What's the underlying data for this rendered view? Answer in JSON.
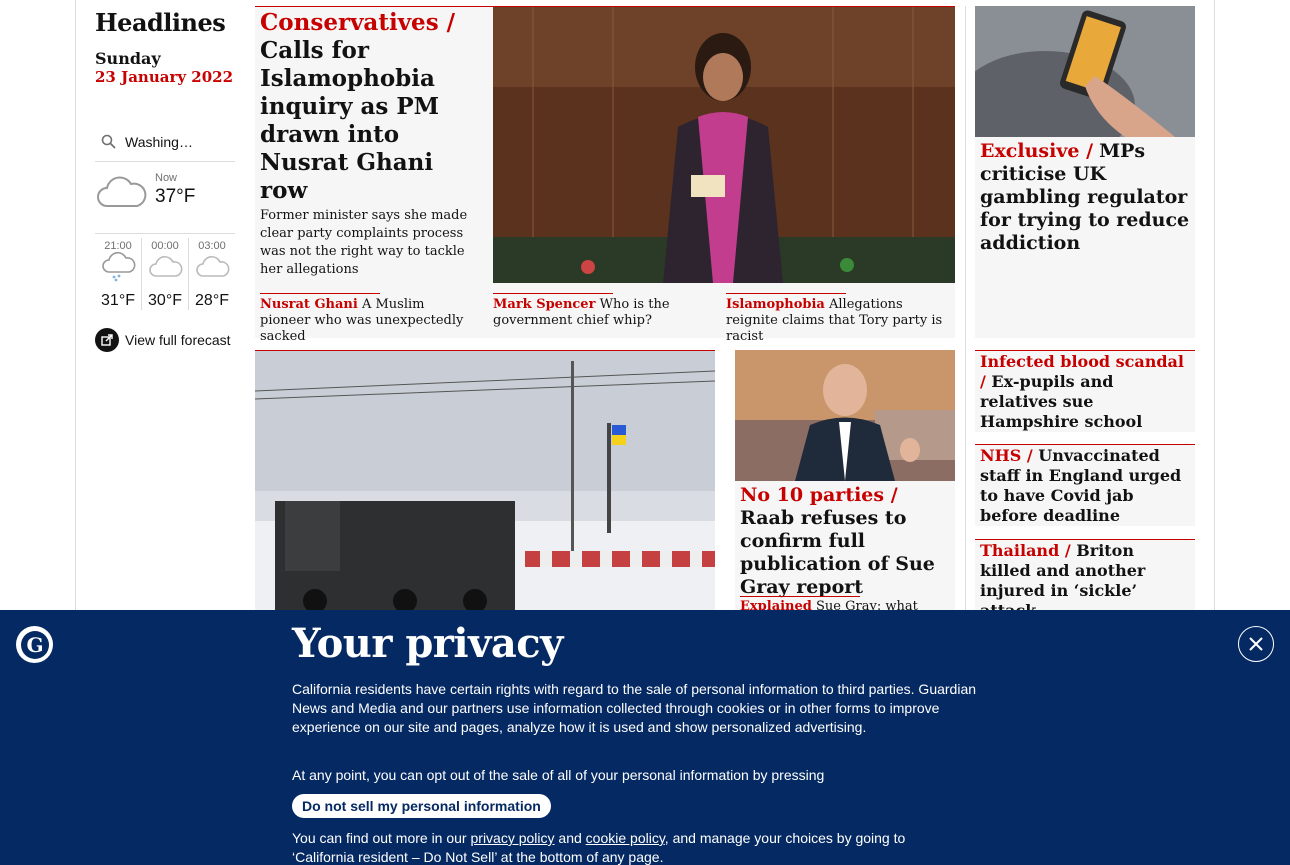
{
  "left": {
    "title": "Headlines",
    "day": "Sunday",
    "date": "23 January 2022",
    "location": "Washing…",
    "now_label": "Now",
    "now_temp": "37°F",
    "forecast": [
      {
        "time": "21:00",
        "temp": "31°F",
        "icon": "sleet-cloud-icon"
      },
      {
        "time": "00:00",
        "temp": "30°F",
        "icon": "partly-cloudy-night-icon"
      },
      {
        "time": "03:00",
        "temp": "28°F",
        "icon": "partly-cloudy-night-icon"
      }
    ],
    "full_forecast": "View full forecast"
  },
  "main_story": {
    "kicker": "Conservatives /",
    "headline": "Calls for Islamophobia inquiry as PM drawn into Nusrat Ghani row",
    "standfirst": "Former minister says she made clear party complaints process was not the right way to tackle her allegations",
    "subs": [
      {
        "kicker": "Nusrat Ghani",
        "text": "A Muslim pioneer who was unexpectedly sacked"
      },
      {
        "kicker": "Mark Spencer",
        "text": "Who is the government chief whip?"
      },
      {
        "kicker": "Islamophobia",
        "text": "Allegations reignite claims that Tory party is racist"
      }
    ]
  },
  "right_top": {
    "kicker": "Exclusive /",
    "headline": "MPs criticise UK gambling regulator for trying to reduce addiction"
  },
  "raab_story": {
    "kicker": "No 10 parties /",
    "headline": "Raab refuses to confirm full publication of Sue Gray report",
    "sub_kicker": "Explained",
    "sub_text": "Sue Gray: what"
  },
  "right_list": [
    {
      "kicker": "Infected blood scandal /",
      "headline": "Ex-pupils and relatives sue Hampshire school"
    },
    {
      "kicker": "NHS /",
      "headline": "Unvaccinated staff in England urged to have Covid jab before deadline"
    },
    {
      "kicker": "Thailand /",
      "headline": "Briton killed and another injured in ‘sickle’ attack"
    }
  ],
  "privacy": {
    "title": "Your privacy",
    "para1": "California residents have certain rights with regard to the sale of personal information to third parties. Guardian News and Media and our partners use information collected through cookies or in other forms to improve experience on our site and pages, analyze how it is used and show personalized advertising.",
    "para2": "At any point, you can opt out of the sale of all of your personal information by pressing",
    "button": "Do not sell my personal information",
    "para3_a": "You can find out more in our",
    "privacy_link": "privacy policy",
    "and": "and",
    "cookie_link": "cookie policy",
    "para3_b": ", and manage your choices by going to ‘California resident – Do Not Sell’ at the bottom of any page."
  },
  "colors": {
    "accent": "#c70000",
    "banner": "#052962",
    "card": "#f6f6f6"
  }
}
